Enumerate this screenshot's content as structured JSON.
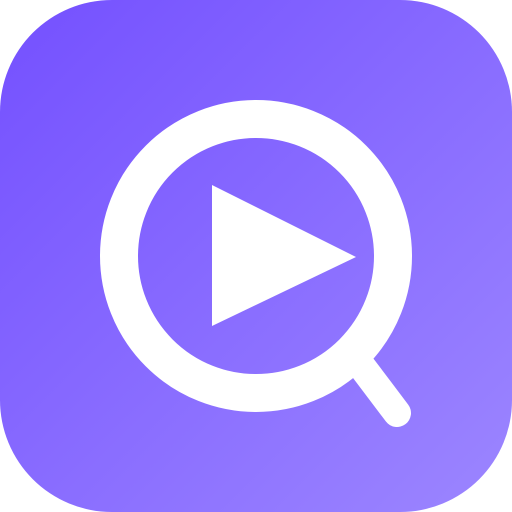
{
  "icon": {
    "name": "video-search-app-icon",
    "glyphs": [
      "magnifying-glass-icon",
      "play-icon"
    ],
    "colors": {
      "gradient_start": "#7450FF",
      "gradient_end": "#9C86FF",
      "glyph": "#FFFFFF"
    }
  }
}
